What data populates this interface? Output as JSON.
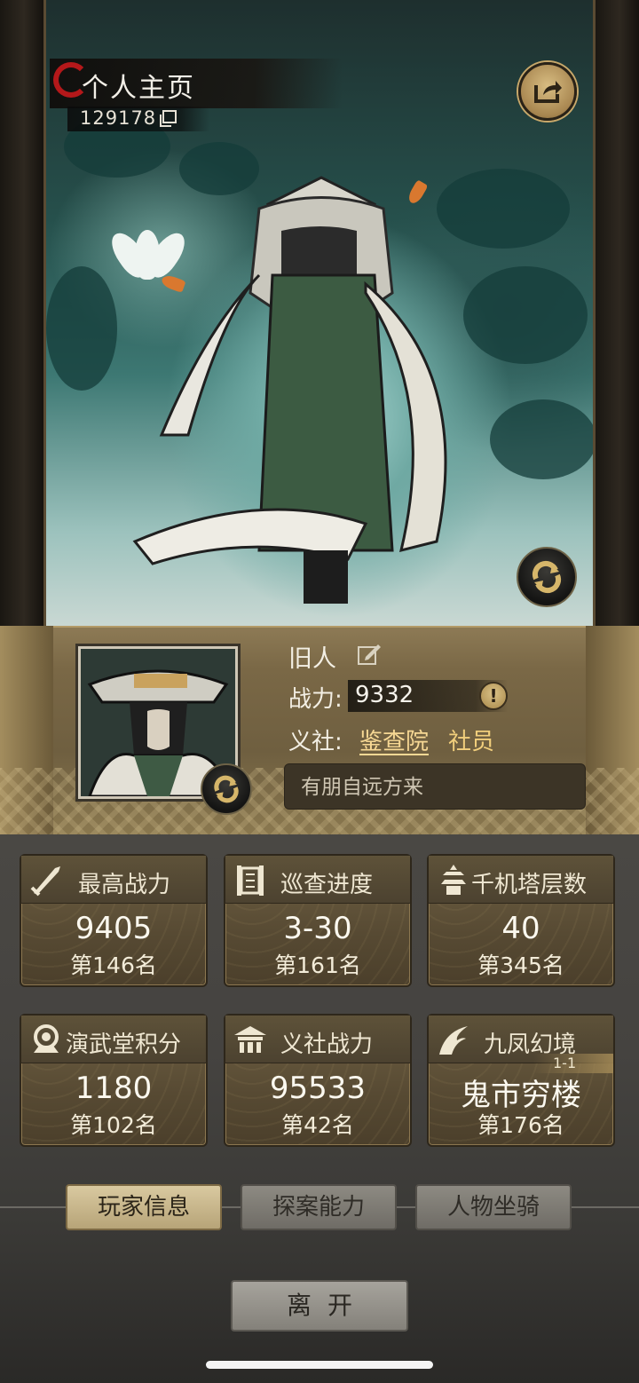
{
  "header": {
    "title": "个人主页",
    "player_id": "129178"
  },
  "profile": {
    "nickname": "旧人",
    "power_label": "战力:",
    "power_value": "9332",
    "guild_label": "义社:",
    "guild_name": "鉴查院",
    "guild_role": "社员",
    "motto": "有朋自远方来"
  },
  "stats": [
    {
      "title": "最高战力",
      "icon": "sword-icon",
      "value": "9405",
      "rank": "第146名"
    },
    {
      "title": "巡查进度",
      "icon": "scroll-icon",
      "value": "3-30",
      "rank": "第161名"
    },
    {
      "title": "千机塔层数",
      "icon": "pagoda-icon",
      "value": "40",
      "rank": "第345名"
    },
    {
      "title": "演武堂积分",
      "icon": "medal-icon",
      "value": "1180",
      "rank": "第102名"
    },
    {
      "title": "义社战力",
      "icon": "hall-icon",
      "value": "95533",
      "rank": "第42名"
    },
    {
      "title": "九凤幻境",
      "icon": "phoenix-icon",
      "value": "鬼市穷楼",
      "sub": "1-1",
      "rank": "第176名"
    }
  ],
  "tabs": [
    {
      "label": "玩家信息",
      "active": true
    },
    {
      "label": "探案能力",
      "active": false
    },
    {
      "label": "人物坐骑",
      "active": false
    }
  ],
  "leave_label": "离开",
  "colors": {
    "gold_accent": "#c8a86a",
    "guild_name": "#f7d894",
    "title_red": "#b4181a"
  }
}
